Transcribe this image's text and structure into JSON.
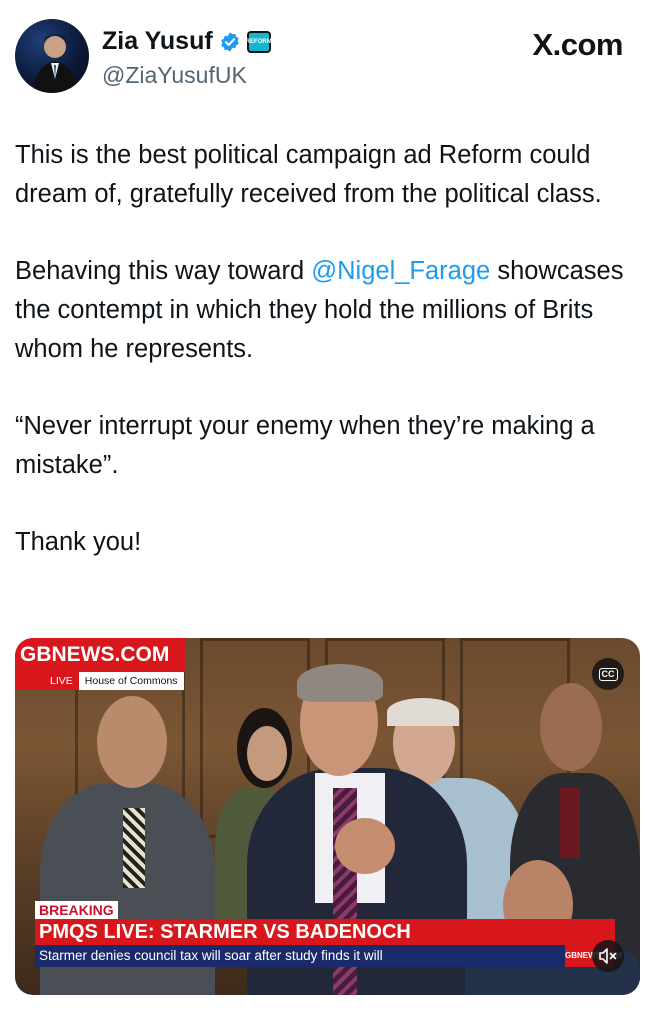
{
  "author": {
    "name": "Zia Yusuf",
    "handle": "@ZiaYusufUK",
    "verified_icon": "verified-badge-icon",
    "affiliation_icon": "reform-affiliate-badge-icon",
    "affiliation_badge_text": "REFORM"
  },
  "source": {
    "brand": "X.com"
  },
  "tweet": {
    "p1": "This is the best political campaign ad Reform could dream of, gratefully received from the political class.",
    "p2_before": "Behaving this way toward ",
    "p2_mention": "@Nigel_Farage",
    "p2_after": " showcases the contempt in which they hold the millions of Brits whom he represents.",
    "p3": "“Never interrupt your enemy when they’re making a mistake”.",
    "p4": "Thank you!"
  },
  "video": {
    "channel_logo": "GBNEWS.COM",
    "live_label": "LIVE",
    "location_label": "House of Commons",
    "cc_label": "CC",
    "breaking_label": "BREAKING",
    "headline": "PMQS LIVE: STARMER VS BADENOCH",
    "subheadline": "Starmer denies council tax will soar after study finds it will",
    "corner_logo": "GBNEWS.COM",
    "mute_icon": "speaker-muted-icon"
  },
  "colors": {
    "text": "#0f1419",
    "secondary": "#536471",
    "link": "#1d9bf0",
    "gb_red": "#d8171d",
    "gb_navy": "#1b2a6b"
  }
}
